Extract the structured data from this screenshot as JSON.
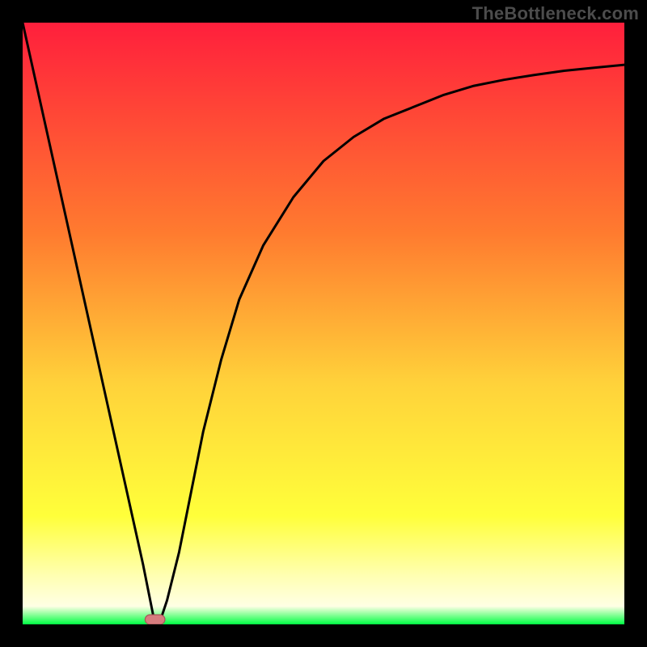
{
  "watermark": "TheBottleneck.com",
  "colors": {
    "frame": "#000000",
    "gradient_top": "#ff1f3c",
    "gradient_mid_upper": "#ff7b2f",
    "gradient_mid": "#ffd23a",
    "gradient_mid_lower": "#ffff3a",
    "gradient_pale": "#ffffb3",
    "gradient_green": "#00ff43",
    "curve_stroke": "#000000",
    "pill_fill": "#d67c7e",
    "pill_stroke": "#a55558"
  },
  "chart_data": {
    "type": "line",
    "title": "",
    "xlabel": "",
    "ylabel": "",
    "xlim": [
      0,
      100
    ],
    "ylim": [
      0,
      100
    ],
    "series": [
      {
        "name": "bottleneck-curve",
        "x": [
          0,
          4,
          8,
          12,
          16,
          20,
          21,
          22,
          23,
          24,
          26,
          28,
          30,
          33,
          36,
          40,
          45,
          50,
          55,
          60,
          65,
          70,
          75,
          80,
          85,
          90,
          95,
          100
        ],
        "y": [
          100,
          82,
          64,
          46,
          28,
          10,
          5,
          0,
          1,
          4,
          12,
          22,
          32,
          44,
          54,
          63,
          71,
          77,
          81,
          84,
          86,
          88,
          89.5,
          90.5,
          91.3,
          92,
          92.5,
          93
        ]
      }
    ],
    "markers": [
      {
        "name": "min-pill",
        "x": 22,
        "y": 0.8,
        "w": 3.3,
        "h": 1.6
      }
    ],
    "legend": false,
    "grid": false
  }
}
